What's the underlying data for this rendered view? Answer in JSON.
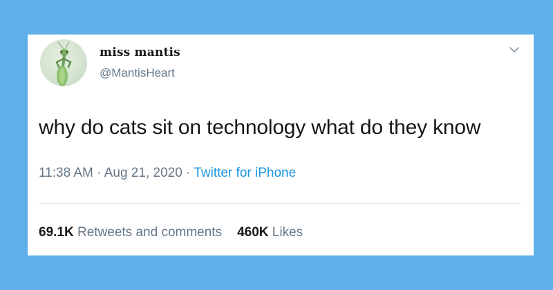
{
  "tweet": {
    "display_name": "miss mantis",
    "handle": "@MantisHeart",
    "text": "why do cats sit on technology what do they know",
    "time": "11:38 AM",
    "separator1": " · ",
    "date": "Aug 21, 2020",
    "separator2": " · ",
    "source": "Twitter for iPhone",
    "retweets_count": "69.1K",
    "retweets_label": " Retweets and comments",
    "likes_count": "460K",
    "likes_label": " Likes"
  },
  "icons": {
    "avatar": "praying-mantis-avatar",
    "menu": "chevron-down-icon"
  },
  "colors": {
    "background": "#5fb0e8",
    "card": "#ffffff",
    "text": "#14171a",
    "muted": "#657786",
    "link": "#1b95e0"
  }
}
